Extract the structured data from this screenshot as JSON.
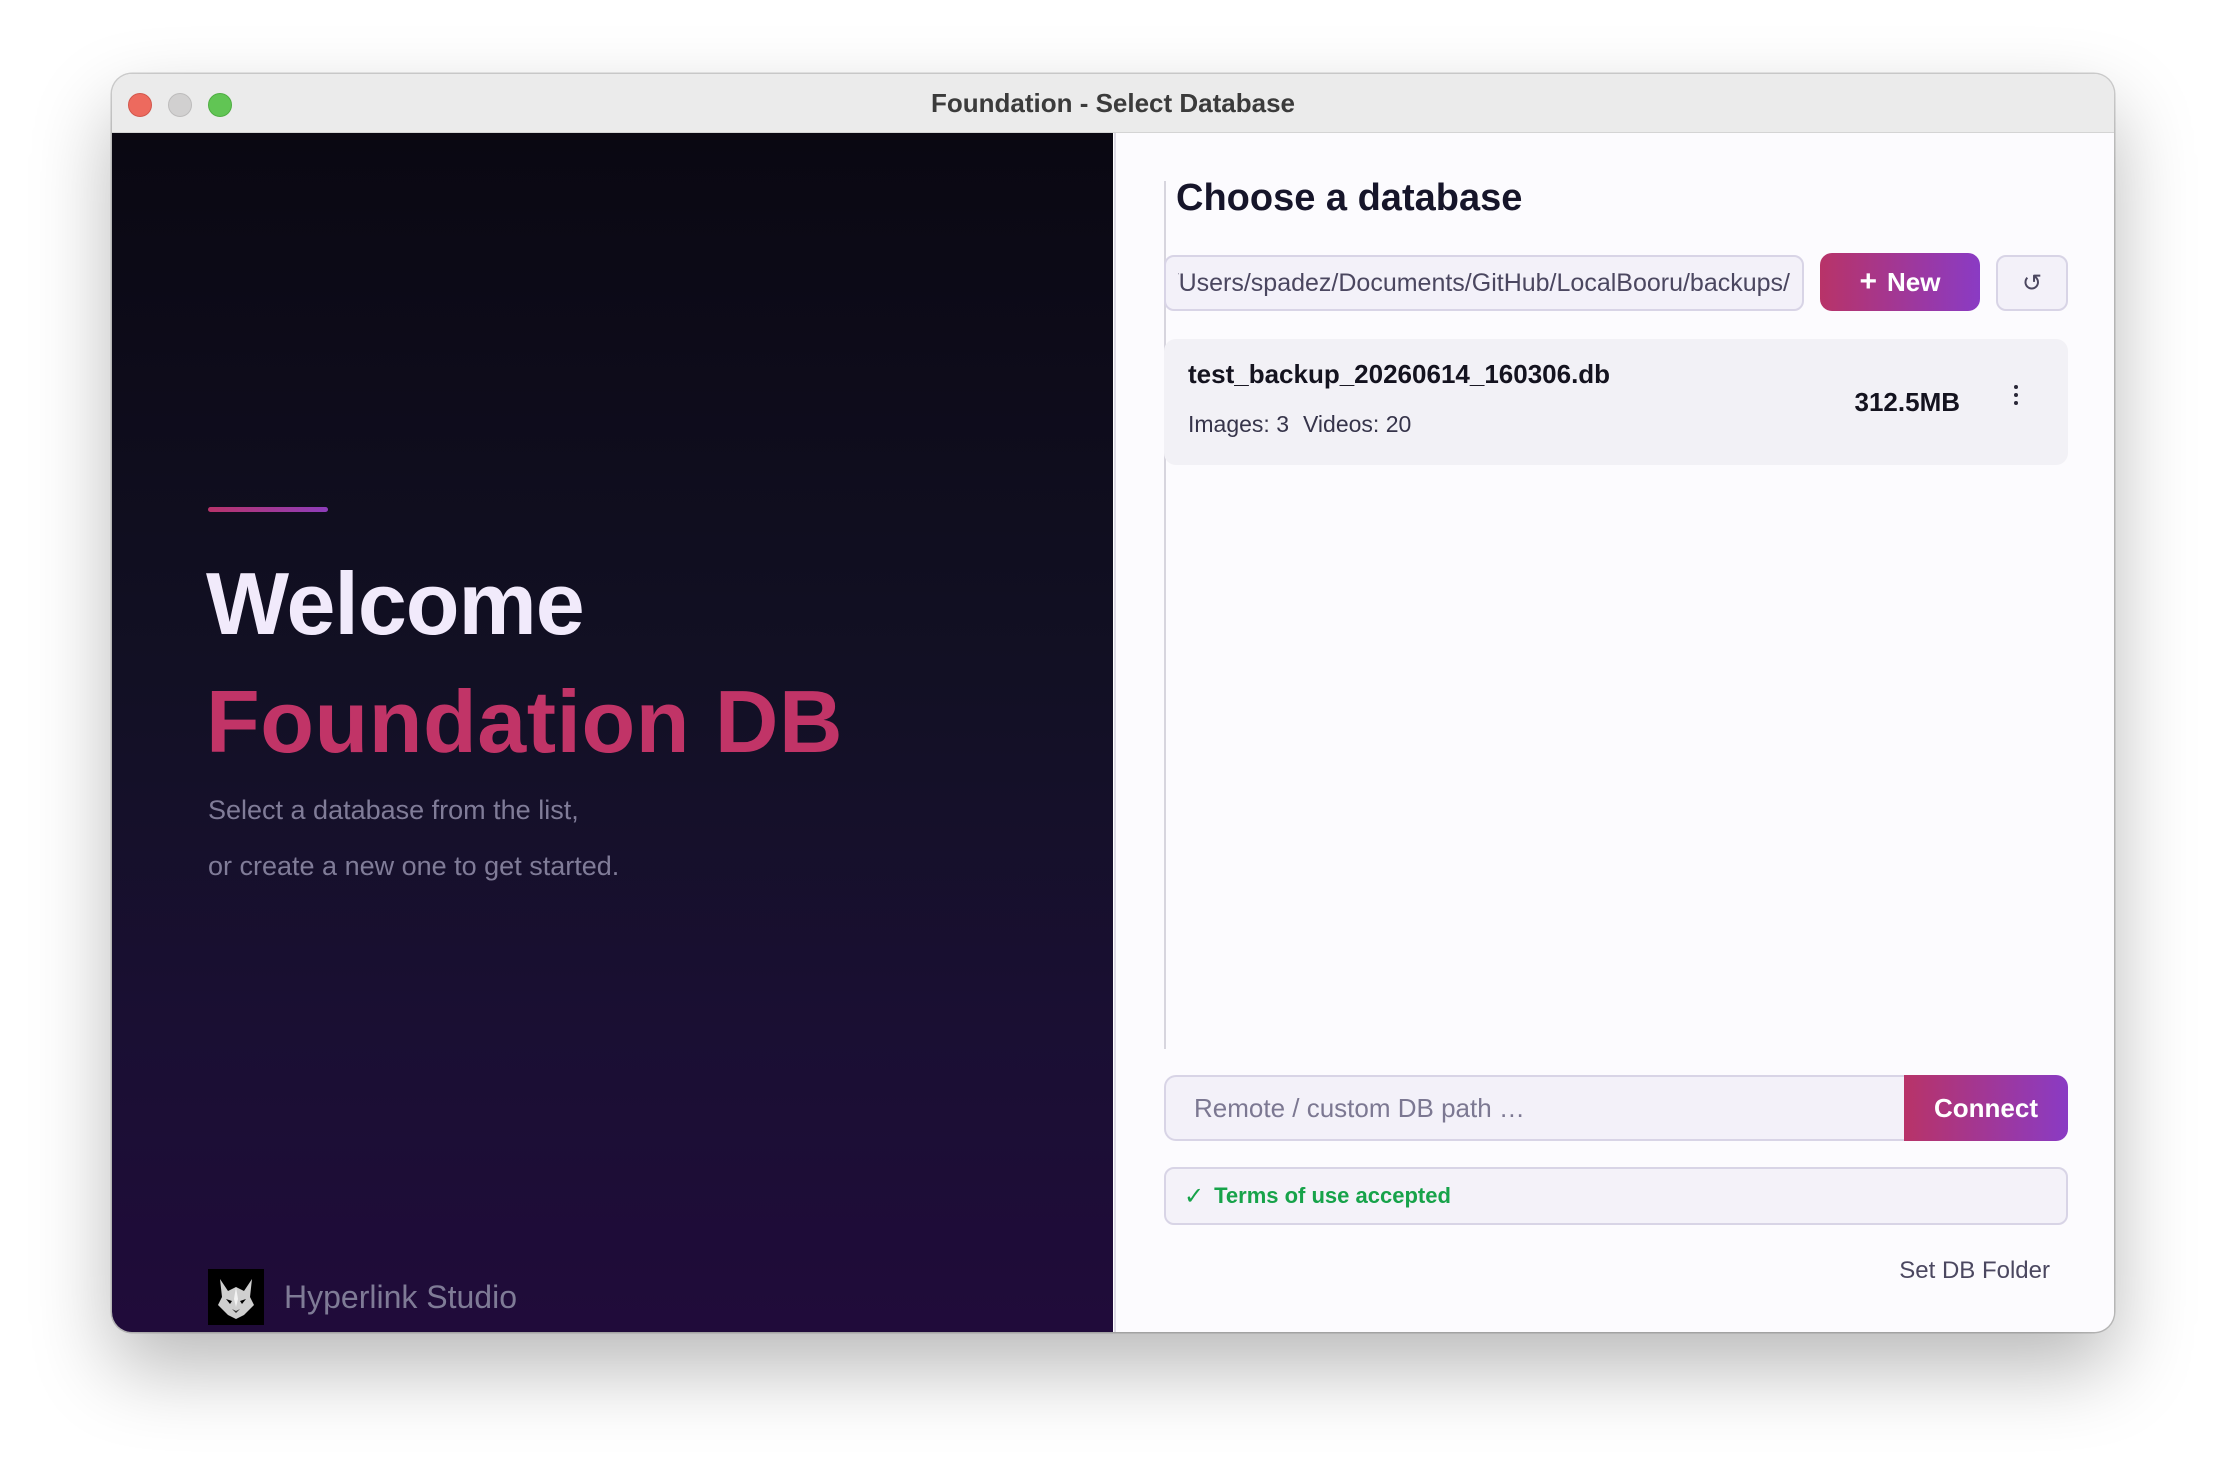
{
  "window": {
    "title": "Foundation - Select Database"
  },
  "left": {
    "welcome": "Welcome",
    "brand": "Foundation DB",
    "subtitle_line1": "Select a database from the list,",
    "subtitle_line2": "or create a new one to get started.",
    "studio_name": "Hyperlink Studio",
    "studio_logo_icon": "wolf-logo-icon"
  },
  "right": {
    "heading": "Choose a database",
    "folder_path": "/Users/spadez/Documents/GitHub/LocalBooru/backups/",
    "new_button_label": "New",
    "new_button_icon": "plus-icon",
    "refresh_icon": "refresh-icon",
    "databases": [
      {
        "name": "test_backup_20260614_160306.db",
        "images": "Images: 3",
        "videos": "Videos: 20",
        "size": "312.5MB"
      }
    ],
    "remote_placeholder": "Remote / custom DB path …",
    "connect_label": "Connect",
    "terms_check": "✓",
    "terms_text": "Terms of use accepted",
    "set_folder_label": "Set DB Folder"
  },
  "colors": {
    "accent": "#c13467",
    "accent_gradient_end": "#8a3bc4",
    "success": "#17a34a",
    "left_background": "#120f22"
  }
}
